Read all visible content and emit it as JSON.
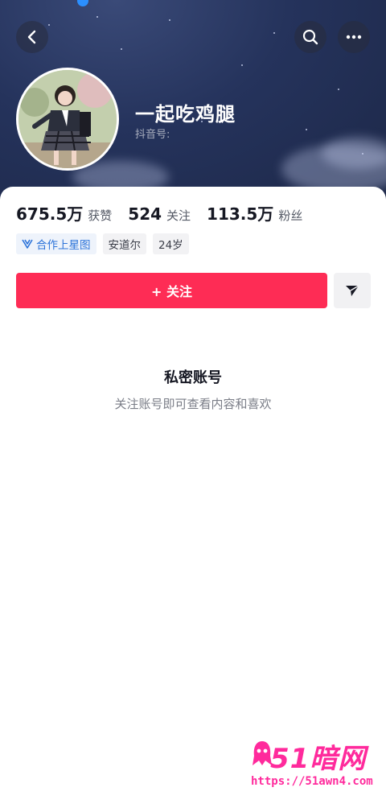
{
  "profile": {
    "name": "一起吃鸡腿",
    "douyin_id_label": "抖音号:"
  },
  "stats": [
    {
      "value": "675.5万",
      "label": "获赞"
    },
    {
      "value": "524",
      "label": "关注"
    },
    {
      "value": "113.5万",
      "label": "粉丝"
    }
  ],
  "tags": {
    "xingtu": "合作上星图",
    "location": "安道尔",
    "age": "24岁"
  },
  "actions": {
    "follow_label": "+ 关注"
  },
  "private_notice": {
    "title": "私密账号",
    "subtitle": "关注账号即可查看内容和喜欢"
  },
  "watermark": {
    "logo_text": "51暗网",
    "url": "https://51awn4.com"
  },
  "colors": {
    "follow": "#fe2c55",
    "header_bg": "#25335c",
    "watermark": "#ff2a9c",
    "xingtu": "#2c73d9"
  },
  "icons": [
    "back-icon",
    "search-icon",
    "more-icon",
    "share-icon",
    "xingtu-icon"
  ]
}
